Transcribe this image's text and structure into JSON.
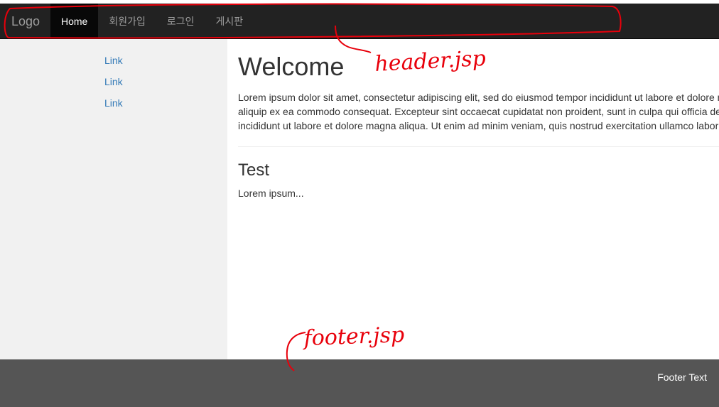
{
  "navbar": {
    "brand": "Logo",
    "items": [
      {
        "label": "Home",
        "active": true
      },
      {
        "label": "회원가입",
        "active": false
      },
      {
        "label": "로그인",
        "active": false
      },
      {
        "label": "게시판",
        "active": false
      }
    ]
  },
  "sidebar": {
    "links": [
      "Link",
      "Link",
      "Link"
    ]
  },
  "main": {
    "title": "Welcome",
    "paragraph_lines": [
      "Lorem ipsum dolor sit amet, consectetur adipiscing elit, sed do eiusmod tempor incididunt ut labore et dolore m",
      "aliquip ex ea commodo consequat. Excepteur sint occaecat cupidatat non proident, sunt in culpa qui officia de",
      "incididunt ut labore et dolore magna aliqua. Ut enim ad minim veniam, quis nostrud exercitation ullamco labor"
    ],
    "section_title": "Test",
    "section_text": "Lorem ipsum..."
  },
  "footer": {
    "text": "Footer Text"
  },
  "annotations": {
    "header_label": "header.jsp",
    "footer_label": "footer.jsp",
    "color": "#e8000b"
  },
  "colors": {
    "navbar_bg": "#222222",
    "active_bg": "#080808",
    "sidebar_bg": "#f1f1f1",
    "link": "#337ab7",
    "footer_bg": "#555555"
  }
}
